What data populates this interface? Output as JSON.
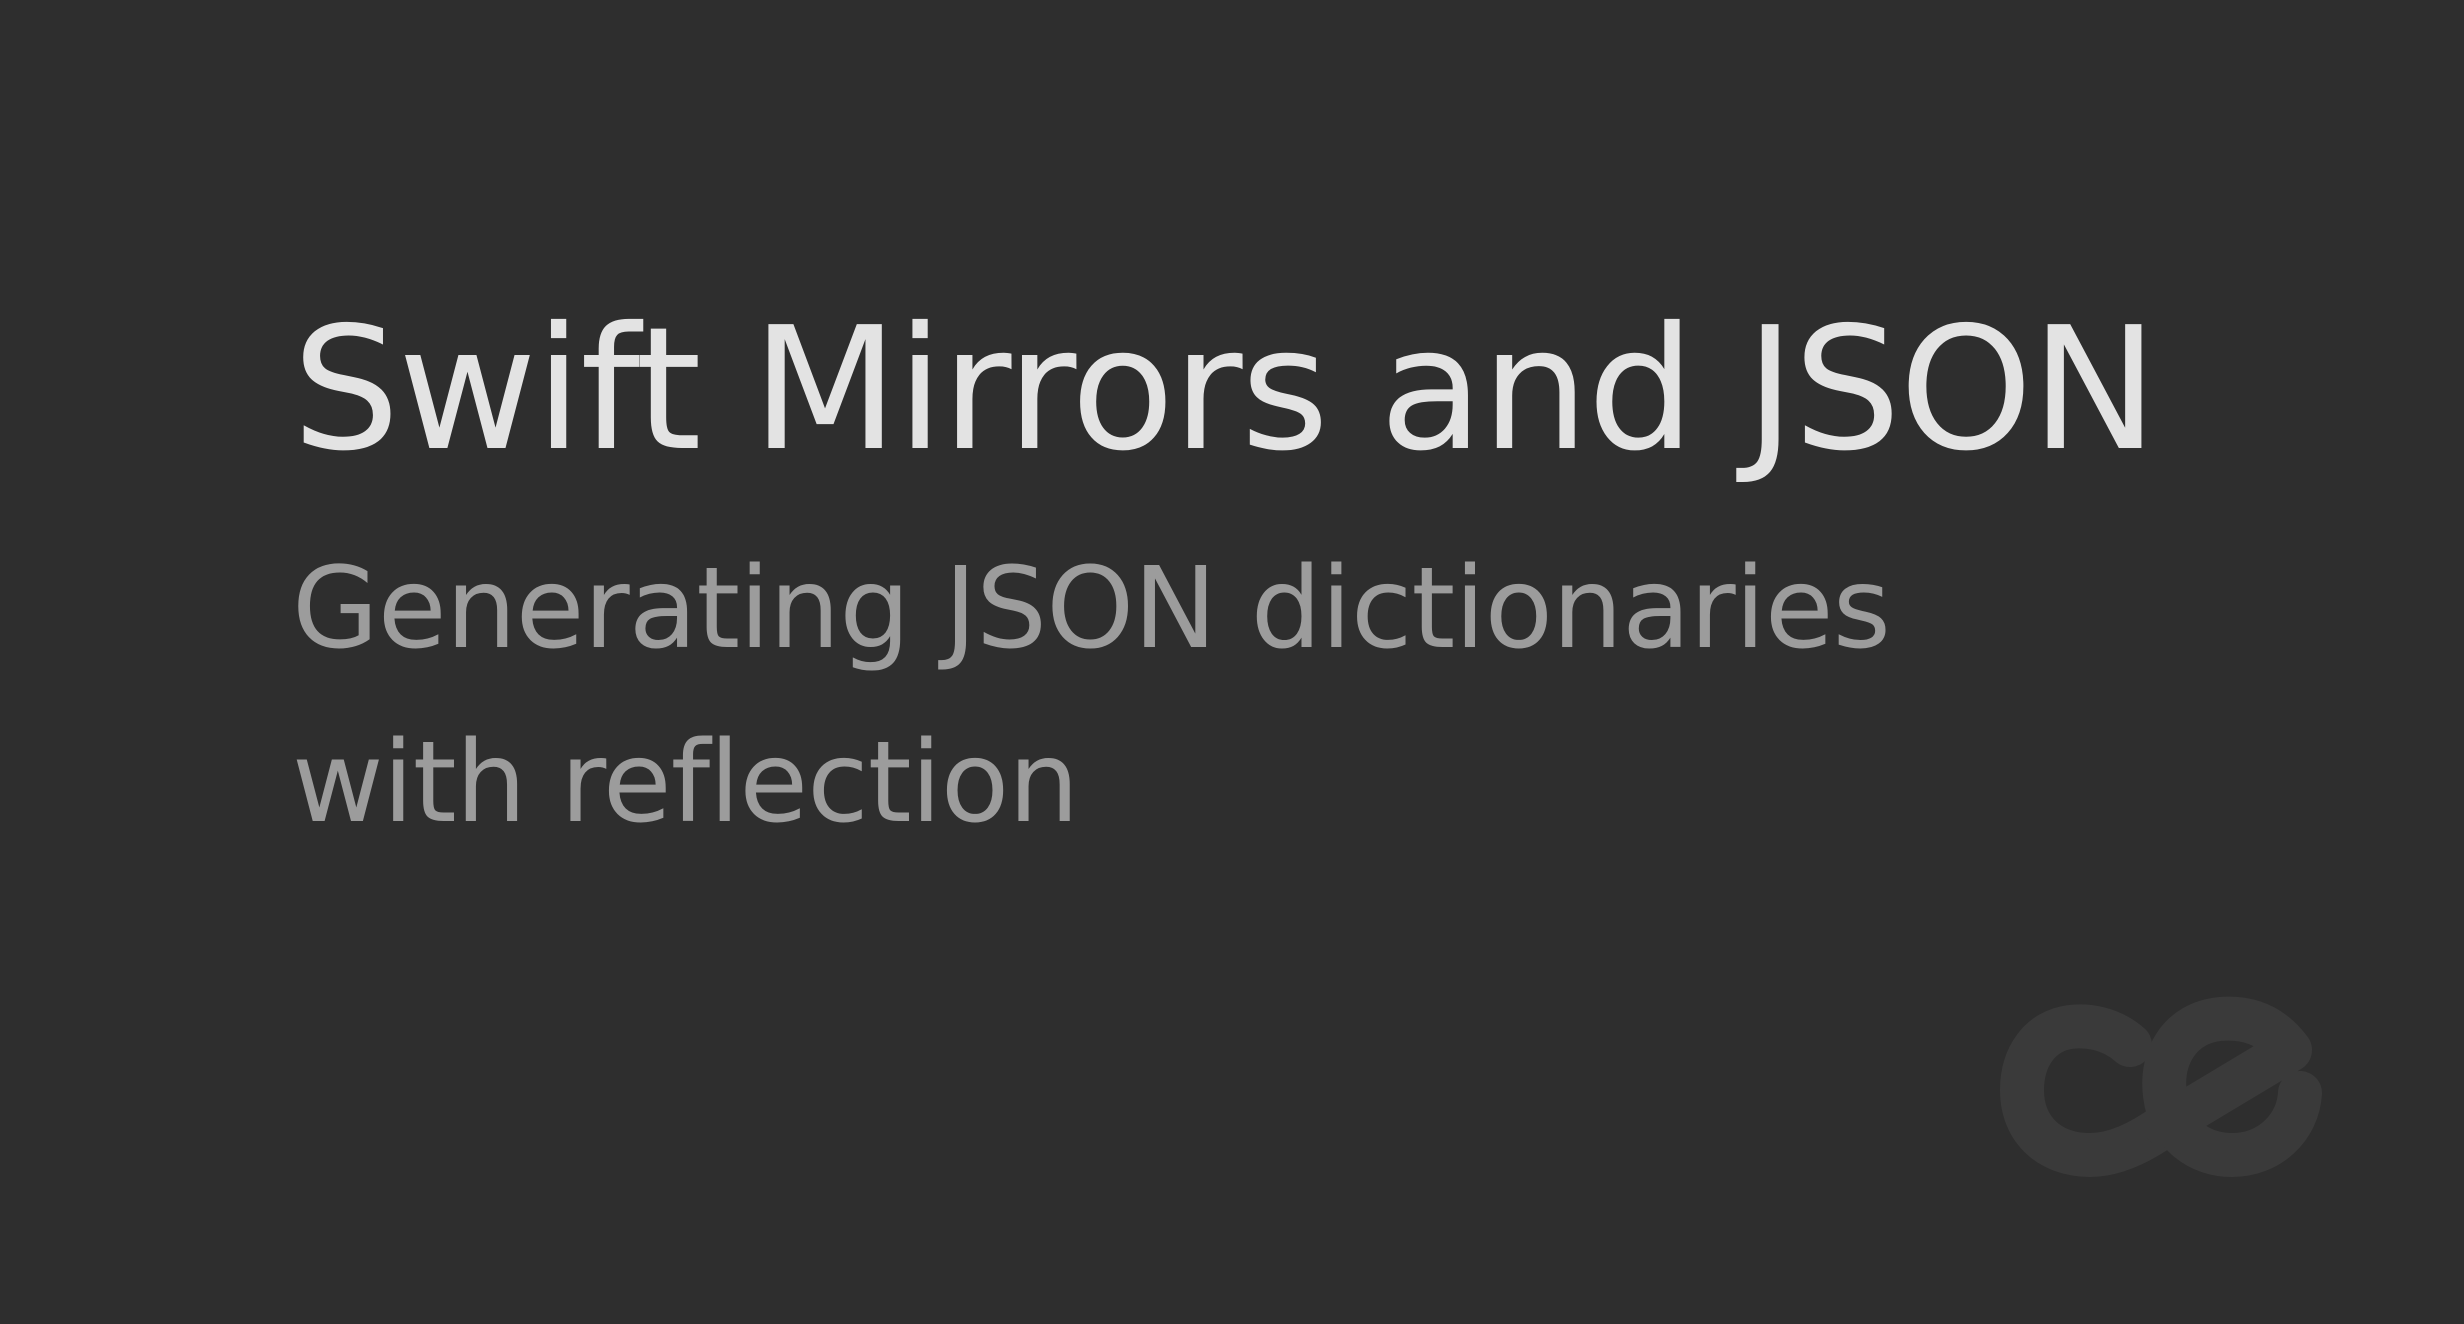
{
  "header": {
    "title": "Swift Mirrors and JSON",
    "subtitle": "Generating JSON dictionaries with reflection"
  },
  "logo": {
    "icon": "ce-logo-icon",
    "color": "#3a3a3a"
  },
  "colors": {
    "background": "#2e2e2e",
    "title": "#e3e3e3",
    "subtitle": "#9c9c9c"
  }
}
